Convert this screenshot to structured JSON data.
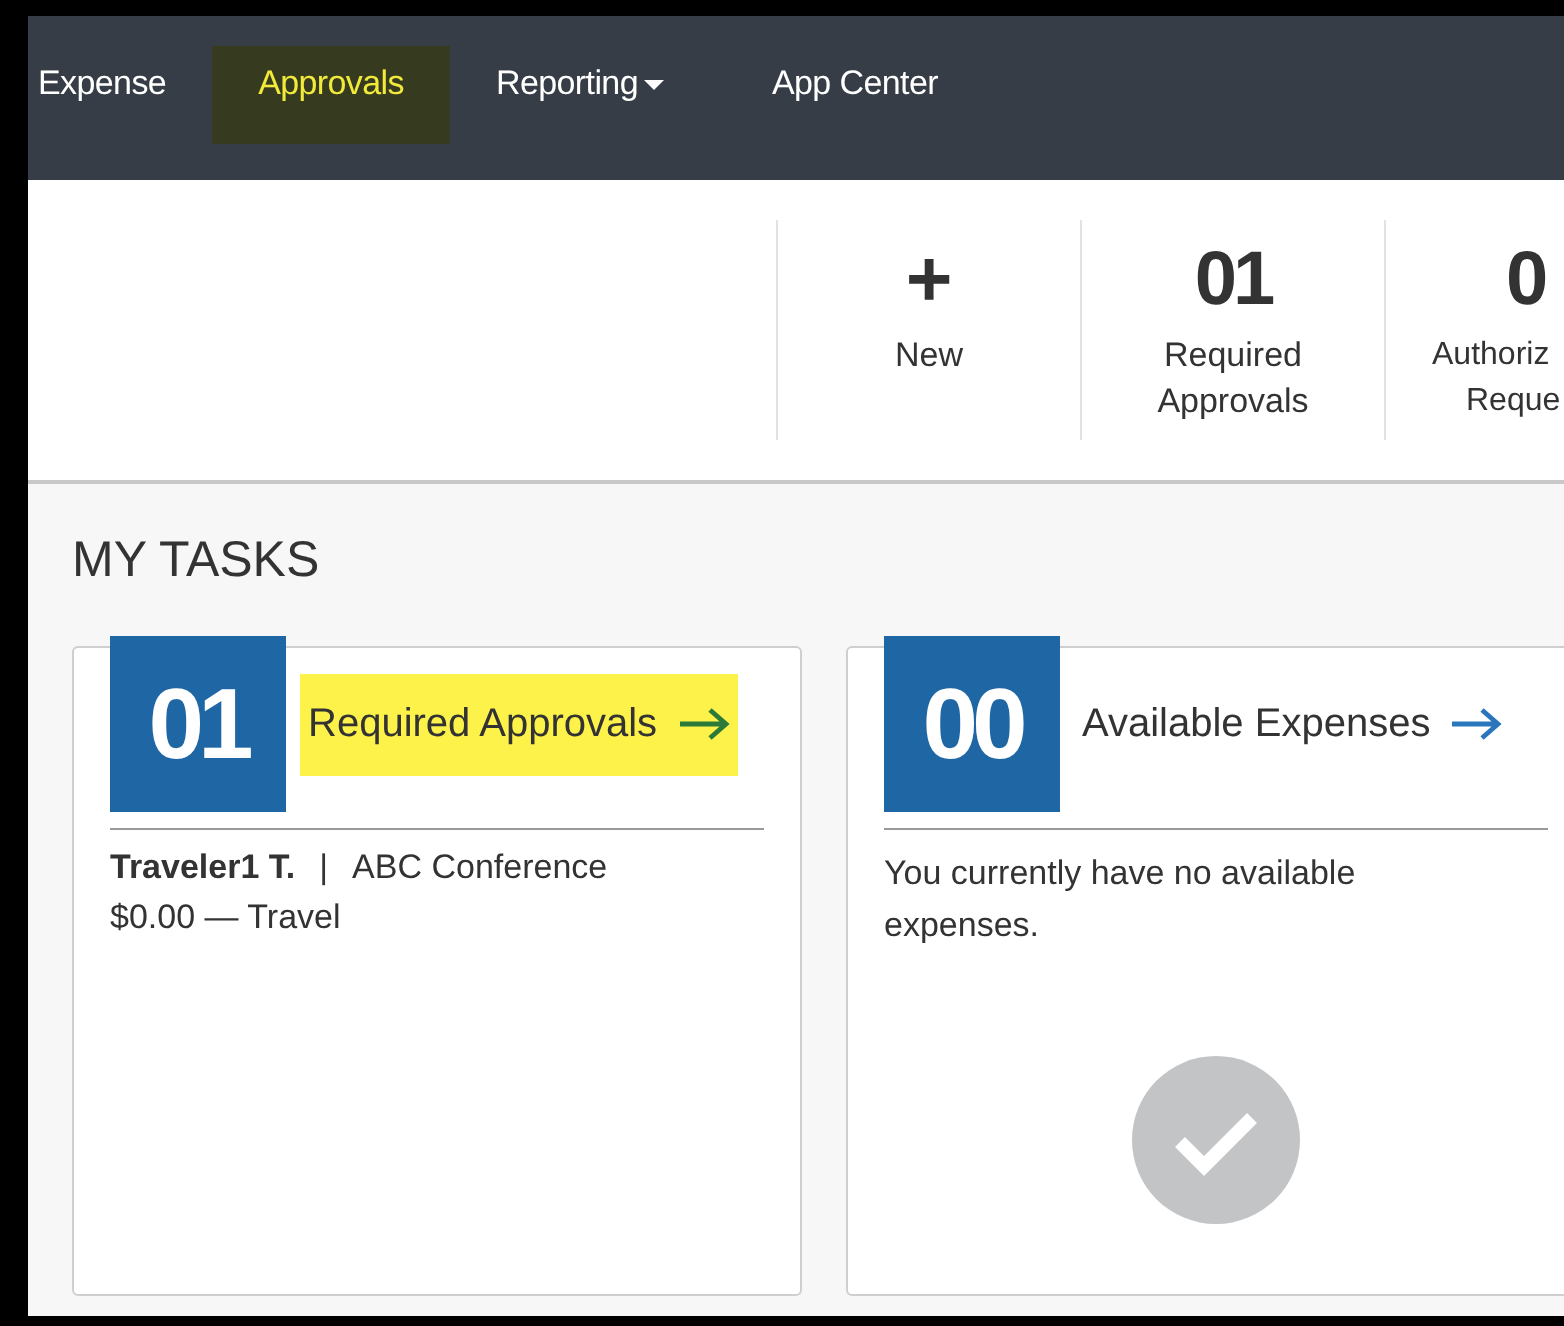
{
  "nav": {
    "items": [
      {
        "label": "Expense",
        "selected": false,
        "dropdown": false
      },
      {
        "label": "Approvals",
        "selected": true,
        "dropdown": false
      },
      {
        "label": "Reporting",
        "selected": false,
        "dropdown": true
      },
      {
        "label": "App Center",
        "selected": false,
        "dropdown": false
      }
    ]
  },
  "header_actions": [
    {
      "kind": "icon",
      "symbol": "+",
      "label_lines": [
        "New"
      ]
    },
    {
      "kind": "count",
      "count": "01",
      "label_lines": [
        "Required",
        "Approvals"
      ]
    },
    {
      "kind": "count",
      "count": "0",
      "label_lines": [
        "Authoriz",
        "Reque"
      ]
    }
  ],
  "section_title": "MY TASKS",
  "cards": [
    {
      "count": "01",
      "title": "Required Approvals",
      "highlighted": true,
      "kind": "list",
      "entries": [
        {
          "name": "Traveler1 T.",
          "separator": "|",
          "event": "ABC Conference",
          "detail": "$0.00 — Travel"
        }
      ]
    },
    {
      "count": "00",
      "title": "Available Expenses",
      "highlighted": false,
      "kind": "empty",
      "message": "You currently have no available expenses."
    }
  ]
}
